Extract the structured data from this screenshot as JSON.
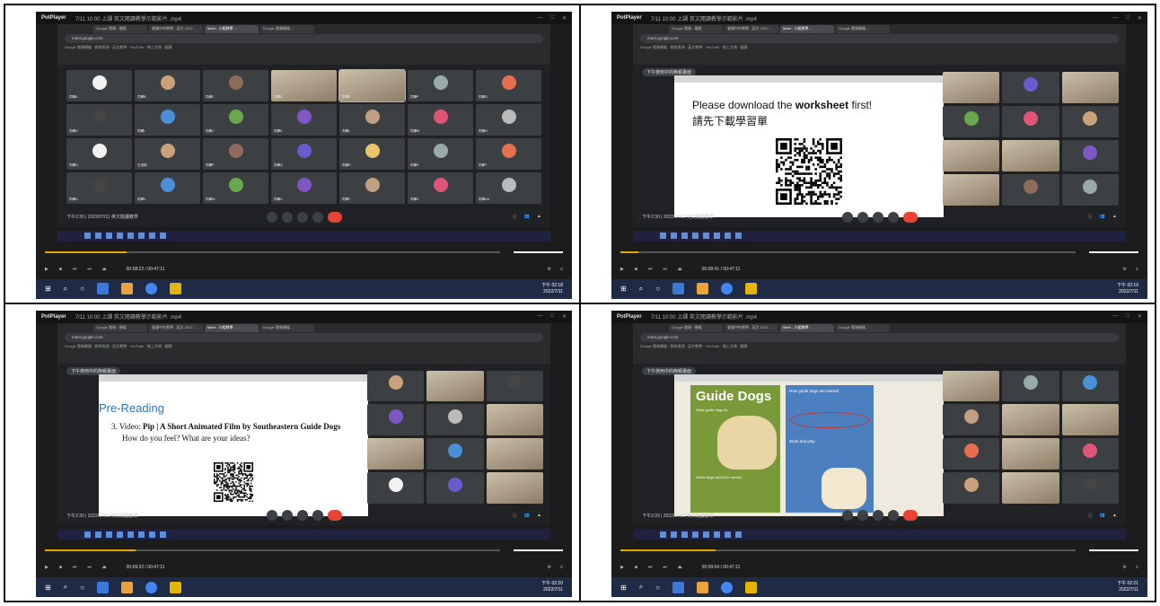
{
  "app": "PotPlayer",
  "file_title": "7/11 10:00 上課 英文閱讀教學示範影片 .mp4",
  "browser": {
    "tabs": [
      "Google 雲端 - 硬碟",
      "會議中的教學 - 英文 2022 ...",
      "Meet - 小組教學 ...",
      "Google 雲端硬碟 ..."
    ],
    "address": "meet.google.com",
    "bookmarks": "Google 雲端硬碟 · 教育資源 · 英文教學 · YouTube · 線上字典 · 翻譯"
  },
  "panels": [
    {
      "mode": "grid",
      "banner": "",
      "meeting_time": "下午2:30 | 2022/07/11 英文閱讀教學",
      "player_time": "00:08:22 / 00:47:11",
      "tiles_names": [
        "同學A",
        "同學B",
        "同學C",
        "同學D",
        "同學E",
        "同學F",
        "同學G",
        "同學H",
        "同學I",
        "同學J",
        "同學K",
        "同學L",
        "同學M",
        "同學N",
        "同學O",
        "王老師",
        "同學P",
        "同學Q",
        "同學R",
        "同學S",
        "同學T",
        "同學U",
        "同學V",
        "同學W",
        "同學X",
        "同學Y",
        "同學Z",
        "同學AA"
      ],
      "clock_time": "下午 02:18",
      "clock_date": "2022/7/11"
    },
    {
      "mode": "slide",
      "banner": "下午使用中的簡報畫面",
      "slide_line1": "Please download the ",
      "slide_bold": "worksheet",
      "slide_line1b": " first!",
      "slide_line2": "請先下載學習單",
      "meeting_time": "下午2:30 | 2022/07/11 英文閱讀教學",
      "player_time": "00:08:41 / 00:47:11",
      "clock_time": "下午 02:19",
      "clock_date": "2022/7/11"
    },
    {
      "mode": "slide",
      "banner": "下午使用中的簡報畫面",
      "slide_h": "Pre-Reading",
      "slide_item": "3.  Video: ",
      "slide_item_bold": "Pip | A Short Animated Film by Southeastern Guide Dogs",
      "slide_q": "How do you feel?   What are your ideas?",
      "meeting_time": "下午2:30 | 2022/07/11 英文閱讀教學",
      "player_time": "00:09:22 / 00:47:11",
      "clock_time": "下午 02:20",
      "clock_date": "2022/7/11"
    },
    {
      "mode": "slide",
      "banner": "下午使用中的簡報畫面",
      "slide_h": "Guide Dogs",
      "box1": "What guide dogs do",
      "box2": "How guide dogs are trained",
      "box3": "Guide dogs and their owners",
      "box4": "Work and play",
      "meeting_time": "下午2:33 | 2022/07/11 英文閱讀教學",
      "player_time": "00:09:54 / 00:47:11",
      "clock_time": "下午 02:21",
      "clock_date": "2022/7/11"
    }
  ]
}
